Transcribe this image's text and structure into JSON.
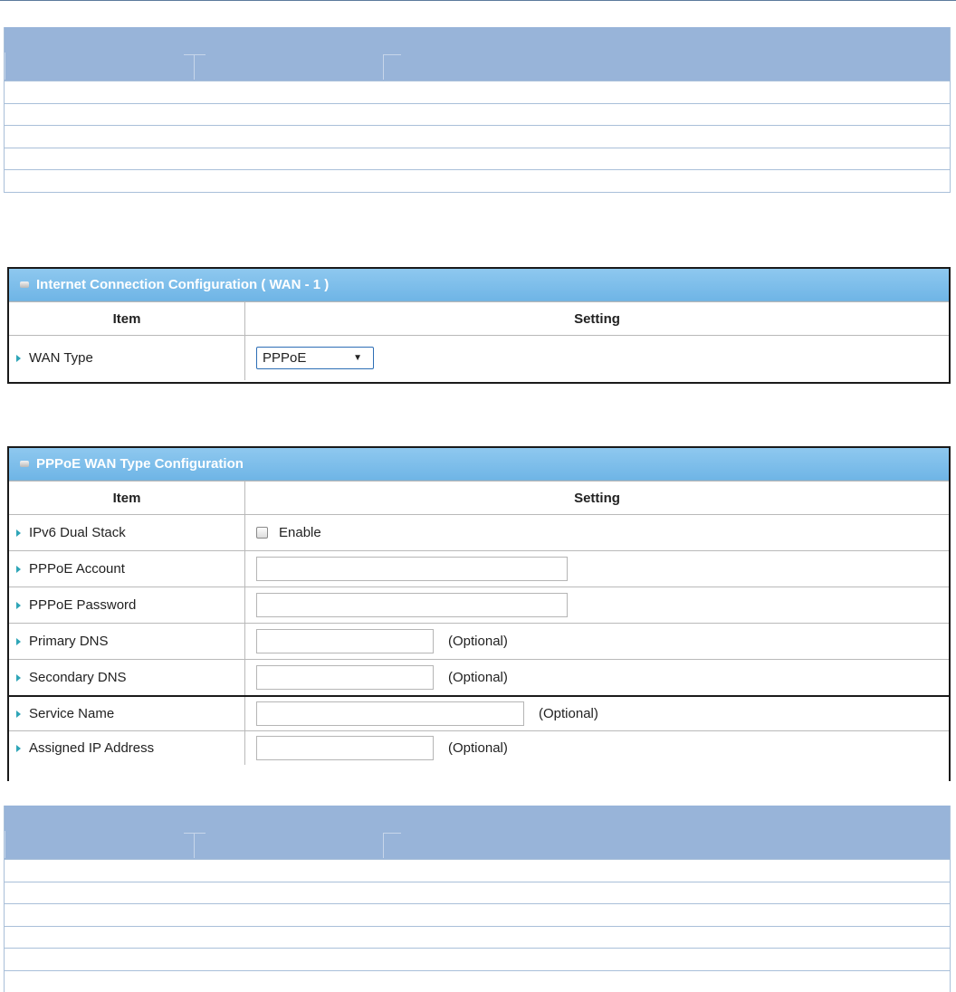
{
  "wan_panel": {
    "title": "Internet Connection Configuration ( WAN - 1 )",
    "col_item": "Item",
    "col_setting": "Setting",
    "wan_type_label": "WAN Type",
    "wan_type_value": "PPPoE"
  },
  "pppoe_panel": {
    "title": "PPPoE WAN Type Configuration",
    "col_item": "Item",
    "col_setting": "Setting",
    "rows": [
      {
        "label": "IPv6 Dual Stack",
        "control": "checkbox",
        "text": "Enable",
        "checked": false
      },
      {
        "label": "PPPoE Account",
        "control": "input",
        "value": ""
      },
      {
        "label": "PPPoE Password",
        "control": "input",
        "value": ""
      },
      {
        "label": "Primary DNS",
        "control": "input",
        "value": "",
        "note": "(Optional)"
      },
      {
        "label": "Secondary DNS",
        "control": "input",
        "value": "",
        "note": "(Optional)"
      },
      {
        "label": "Service Name",
        "control": "input",
        "value": "",
        "note": "(Optional)"
      },
      {
        "label": "Assigned IP Address",
        "control": "input",
        "value": "",
        "note": "(Optional)"
      }
    ]
  },
  "colors": {
    "doc_header": "#98b4d9",
    "panel_title": "#7fbcea",
    "bullet_arrow": "#2ea5b7"
  }
}
